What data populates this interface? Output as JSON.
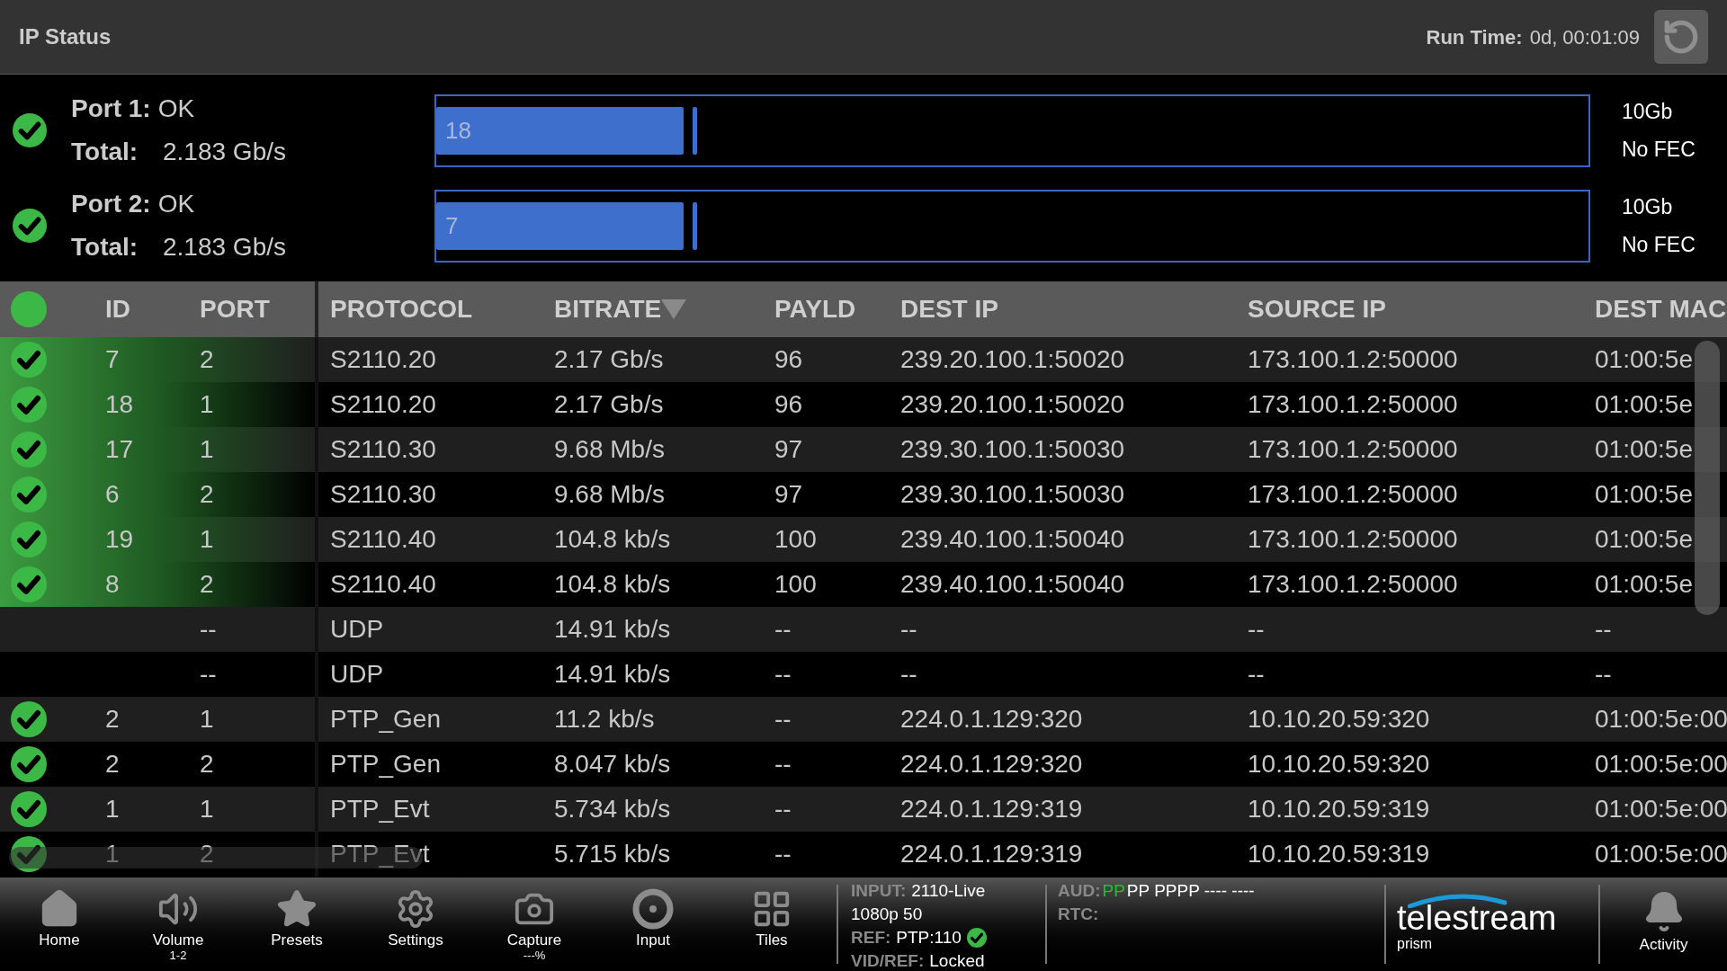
{
  "header": {
    "title": "IP Status",
    "run_time_label": "Run Time:",
    "run_time_value": "0d, 00:01:09"
  },
  "ports": [
    {
      "label": "Port 1:",
      "status": "OK",
      "ok": true,
      "total_label": "Total:",
      "total": "2.183 Gb/s",
      "bar_label": "18",
      "level": 0.215,
      "speed": "10Gb",
      "fec": "No FEC"
    },
    {
      "label": "Port 2:",
      "status": "OK",
      "ok": true,
      "total_label": "Total:",
      "total": "2.183 Gb/s",
      "bar_label": "7",
      "level": 0.215,
      "speed": "10Gb",
      "fec": "No FEC"
    }
  ],
  "table": {
    "columns": [
      {
        "label": "ID",
        "sorted": false
      },
      {
        "label": "PORT",
        "sorted": false
      },
      {
        "label": "PROTOCOL",
        "sorted": false
      },
      {
        "label": "BITRATE",
        "sorted": true
      },
      {
        "label": "PAYLD",
        "sorted": false
      },
      {
        "label": "DEST IP",
        "sorted": false
      },
      {
        "label": "SOURCE IP",
        "sorted": false
      },
      {
        "label": "DEST MAC",
        "sorted": false
      }
    ],
    "rows": [
      {
        "ok": true,
        "highlighted": true,
        "cells": [
          "7",
          "2",
          "S2110.20",
          "2.17 Gb/s",
          "96",
          "239.20.100.1:50020",
          "173.100.1.2:50000",
          "01:00:5e"
        ]
      },
      {
        "ok": true,
        "highlighted": true,
        "cells": [
          "18",
          "1",
          "S2110.20",
          "2.17 Gb/s",
          "96",
          "239.20.100.1:50020",
          "173.100.1.2:50000",
          "01:00:5e"
        ]
      },
      {
        "ok": true,
        "highlighted": true,
        "cells": [
          "17",
          "1",
          "S2110.30",
          "9.68 Mb/s",
          "97",
          "239.30.100.1:50030",
          "173.100.1.2:50000",
          "01:00:5e"
        ]
      },
      {
        "ok": true,
        "highlighted": true,
        "cells": [
          "6",
          "2",
          "S2110.30",
          "9.68 Mb/s",
          "97",
          "239.30.100.1:50030",
          "173.100.1.2:50000",
          "01:00:5e"
        ]
      },
      {
        "ok": true,
        "highlighted": true,
        "cells": [
          "19",
          "1",
          "S2110.40",
          "104.8 kb/s",
          "100",
          "239.40.100.1:50040",
          "173.100.1.2:50000",
          "01:00:5e"
        ]
      },
      {
        "ok": true,
        "highlighted": true,
        "cells": [
          "8",
          "2",
          "S2110.40",
          "104.8 kb/s",
          "100",
          "239.40.100.1:50040",
          "173.100.1.2:50000",
          "01:00:5e"
        ]
      },
      {
        "ok": false,
        "highlighted": false,
        "cells": [
          "",
          "--",
          "UDP",
          "14.91 kb/s",
          "--",
          "--",
          "--",
          "--"
        ]
      },
      {
        "ok": false,
        "highlighted": false,
        "cells": [
          "",
          "--",
          "UDP",
          "14.91 kb/s",
          "--",
          "--",
          "--",
          "--"
        ]
      },
      {
        "ok": true,
        "highlighted": false,
        "cells": [
          "2",
          "1",
          "PTP_Gen",
          "11.2 kb/s",
          "--",
          "224.0.1.129:320",
          "10.10.20.59:320",
          "01:00:5e:00"
        ]
      },
      {
        "ok": true,
        "highlighted": false,
        "cells": [
          "2",
          "2",
          "PTP_Gen",
          "8.047 kb/s",
          "--",
          "224.0.1.129:320",
          "10.10.20.59:320",
          "01:00:5e:00"
        ]
      },
      {
        "ok": true,
        "highlighted": false,
        "cells": [
          "1",
          "1",
          "PTP_Evt",
          "5.734 kb/s",
          "--",
          "224.0.1.129:319",
          "10.10.20.59:319",
          "01:00:5e:00"
        ]
      },
      {
        "ok": true,
        "highlighted": false,
        "cells": [
          "1",
          "2",
          "PTP_Evt",
          "5.715 kb/s",
          "--",
          "224.0.1.129:319",
          "10.10.20.59:319",
          "01:00:5e:00"
        ]
      }
    ]
  },
  "toolbar": [
    {
      "kind": "home",
      "label": "Home"
    },
    {
      "kind": "volume",
      "label": "Volume",
      "sublabel": "1-2"
    },
    {
      "kind": "presets",
      "label": "Presets"
    },
    {
      "kind": "settings",
      "label": "Settings"
    },
    {
      "kind": "capture",
      "label": "Capture",
      "sublabel": "---%"
    },
    {
      "kind": "input",
      "label": "Input"
    },
    {
      "kind": "tiles",
      "label": "Tiles"
    }
  ],
  "info": {
    "input_label": "INPUT:",
    "input_value": "2110-Live",
    "format": "1080p 50",
    "ref_label": "REF:",
    "ref_value": "PTP:110",
    "ref_ok": true,
    "vidref_label": "VID/REF:",
    "vidref_value": "Locked"
  },
  "audio": {
    "label": "AUD:",
    "segments": [
      {
        "text": "PP",
        "color": "#22c02a"
      },
      {
        "text": "PP PPPP ---- ----",
        "color": "#ffffff"
      }
    ],
    "rtc_label": "RTC:"
  },
  "brand": {
    "name": "telestream",
    "product": "prism"
  },
  "activity": {
    "label": "Activity"
  }
}
